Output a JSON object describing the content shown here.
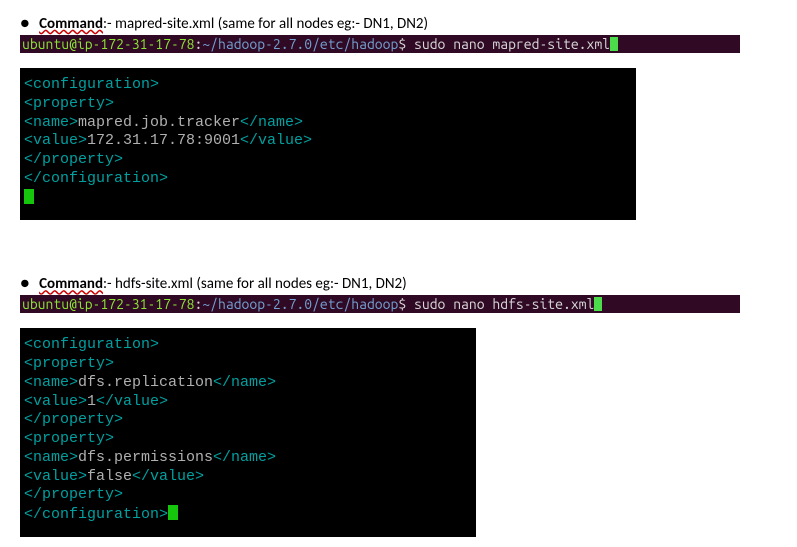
{
  "sec1": {
    "bullet": "●",
    "label": "Command",
    "rest": ":- mapred-site.xml (same for all nodes eg:- DN1, DN2)",
    "prompt": {
      "user": "ubuntu@ip-172-31-17-78",
      "path": "~/hadoop-2.7.0/etc/hadoop",
      "cmd": "sudo nano mapred-site.xml"
    },
    "code": {
      "l1a": "<configuration>",
      "l2a": "<property>",
      "l3a": "<name>",
      "l3b": "mapred.job.tracker",
      "l3c": "</name>",
      "l4a": "<value>",
      "l4b": "172.31.17.78:9001",
      "l4c": "</value>",
      "l5a": "</property>",
      "l6a": "</configuration>"
    }
  },
  "sec2": {
    "bullet": "●",
    "label": "Command",
    "rest": ":- hdfs-site.xml (same for all nodes eg:- DN1, DN2)",
    "prompt": {
      "user": "ubuntu@ip-172-31-17-78",
      "path": "~/hadoop-2.7.0/etc/hadoop",
      "cmd": "sudo nano hdfs-site.xml"
    },
    "code": {
      "l1a": "<configuration>",
      "l2a": "<property>",
      "l3a": "<name>",
      "l3b": "dfs.replication",
      "l3c": "</name>",
      "l4a": "<value>",
      "l4b": "1",
      "l4c": "</value>",
      "l5a": "</property>",
      "l6a": "<property>",
      "l7a": "<name>",
      "l7b": "dfs.permissions",
      "l7c": "</name>",
      "l8a": "<value>",
      "l8b": "false",
      "l8c": "</value>",
      "l9a": "</property>",
      "l10a": "</configuration>"
    }
  }
}
